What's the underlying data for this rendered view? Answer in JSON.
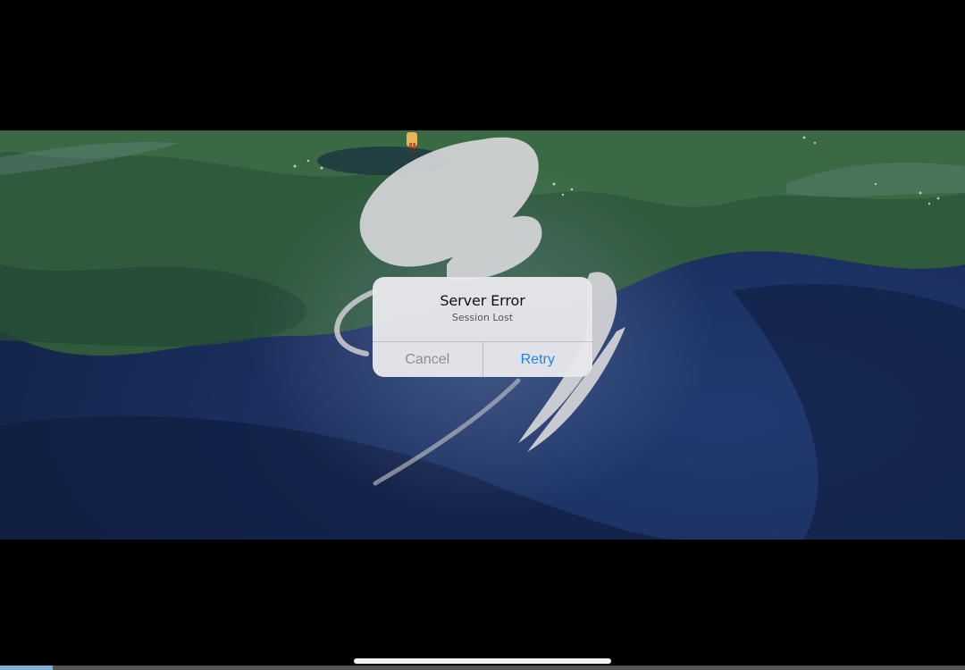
{
  "alert": {
    "title": "Server Error",
    "message": "Session Lost",
    "cancel_label": "Cancel",
    "retry_label": "Retry"
  },
  "colors": {
    "retry_accent": "#1e84f5",
    "cancel_text": "#8e8e93",
    "letterbox": "#000000",
    "home_indicator": "#f2f2f2"
  },
  "progress": {
    "fraction": 0.055
  },
  "icons": {
    "logo": "sky-logo-watermark"
  }
}
